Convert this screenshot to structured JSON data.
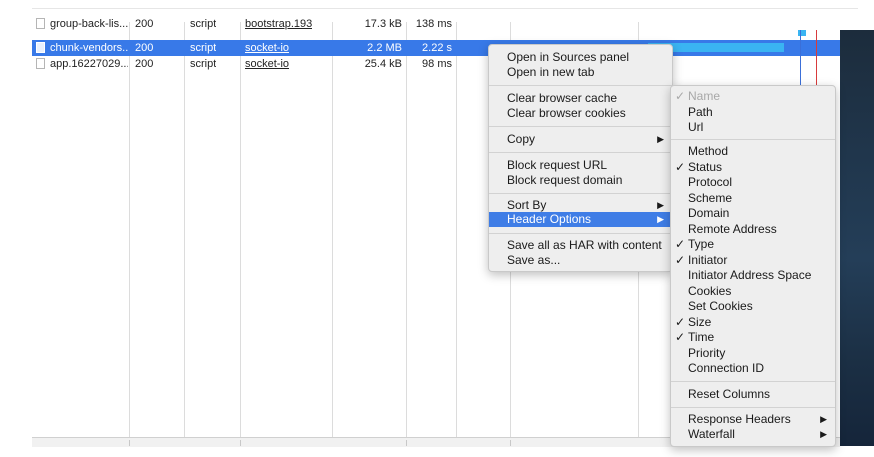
{
  "requests": {
    "rows": [
      {
        "name": "group-back-lis...",
        "status": "200",
        "type": "script",
        "initiator": "bootstrap.193",
        "size": "17.3 kB",
        "time": "138 ms",
        "selected": false
      },
      {
        "name": "chunk-vendors...",
        "status": "200",
        "type": "script",
        "initiator": "socket-io",
        "size": "2.2 MB",
        "time": "2.22 s",
        "selected": true
      },
      {
        "name": "app.16227029...",
        "status": "200",
        "type": "script",
        "initiator": "socket-io",
        "size": "25.4 kB",
        "time": "98 ms",
        "selected": false
      }
    ]
  },
  "context_menu": {
    "items": [
      {
        "label": "Open in Sources panel"
      },
      {
        "label": "Open in new tab"
      },
      {
        "label": "Clear browser cache"
      },
      {
        "label": "Clear browser cookies"
      },
      {
        "label": "Copy",
        "submenu": true
      },
      {
        "label": "Block request URL"
      },
      {
        "label": "Block request domain"
      },
      {
        "label": "Sort By",
        "submenu": true
      },
      {
        "label": "Header Options",
        "submenu": true,
        "highlighted": true
      },
      {
        "label": "Save all as HAR with content"
      },
      {
        "label": "Save as..."
      }
    ]
  },
  "header_options_menu": {
    "items": [
      {
        "label": "Name",
        "checked": true,
        "disabled": true
      },
      {
        "label": "Path",
        "checked": false
      },
      {
        "label": "Url",
        "checked": false
      },
      {
        "label": "Method",
        "checked": false
      },
      {
        "label": "Status",
        "checked": true
      },
      {
        "label": "Protocol",
        "checked": false
      },
      {
        "label": "Scheme",
        "checked": false
      },
      {
        "label": "Domain",
        "checked": false
      },
      {
        "label": "Remote Address",
        "checked": false
      },
      {
        "label": "Type",
        "checked": true
      },
      {
        "label": "Initiator",
        "checked": true
      },
      {
        "label": "Initiator Address Space",
        "checked": false
      },
      {
        "label": "Cookies",
        "checked": false
      },
      {
        "label": "Set Cookies",
        "checked": false
      },
      {
        "label": "Size",
        "checked": true
      },
      {
        "label": "Time",
        "checked": true
      },
      {
        "label": "Priority",
        "checked": false
      },
      {
        "label": "Connection ID",
        "checked": false
      },
      {
        "label": "Reset Columns"
      },
      {
        "label": "Response Headers",
        "submenu": true
      },
      {
        "label": "Waterfall",
        "submenu": true
      }
    ],
    "check_glyph": "✓"
  },
  "icons": {
    "submenu_arrow": "▶",
    "file": "document-icon"
  },
  "colors": {
    "selection": "#3879e8",
    "menu_highlight": "#3f7de6",
    "waterfall_bar": "#3ab4f2",
    "dom_content_line": "#3b6fd8",
    "load_line": "#d83b3b"
  }
}
